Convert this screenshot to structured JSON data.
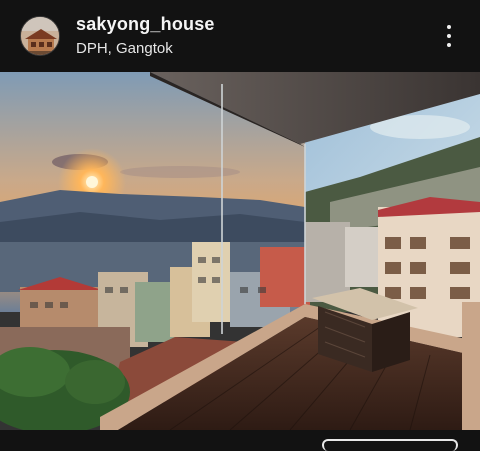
{
  "post": {
    "username": "sakyong_house",
    "location": "DPH, Gangtok"
  },
  "icons": {
    "avatar": "avatar-photo",
    "more": "more-vertical-icon"
  },
  "colors": {
    "background": "#121212",
    "text_primary": "#f5f5f5",
    "sunset_orange": "#f3a04a",
    "sky_blue": "#8fb6d6"
  }
}
